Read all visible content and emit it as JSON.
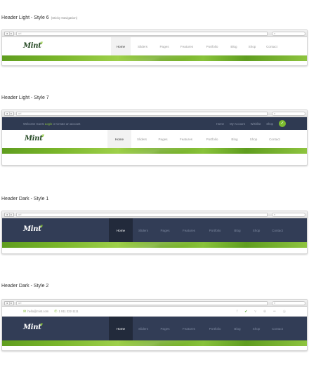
{
  "browser": {
    "nav_buttons": [
      "◂",
      "▸"
    ],
    "url_text": "url",
    "search_icon": "⌕"
  },
  "brand": {
    "logo_text": "Mint",
    "leaf_glyph": "❦",
    "green": "#8dc63f",
    "dark_navy": "#323d56"
  },
  "menu": [
    "Home",
    "Sliders",
    "Pages",
    "Features",
    "Portfolio",
    "Blog",
    "Shop",
    "Contact"
  ],
  "sections": [
    {
      "title": "Header Light - Style 6",
      "subtitle": "(Sticky Navigation)"
    },
    {
      "title": "Header Light - Style 7",
      "subtitle": ""
    },
    {
      "title": "Header Dark - Style 1",
      "subtitle": ""
    },
    {
      "title": "Header Dark - Style 2",
      "subtitle": ""
    }
  ],
  "style7_topbar": {
    "welcome": "Welcome Guest",
    "login": "Login",
    "or_text": "or",
    "create_account": "Create an account",
    "links": [
      "Home",
      "My Account",
      "Wishlist",
      "Shop"
    ],
    "cart_icon": "cart-icon"
  },
  "dark2_topbar": {
    "email": "hello@mint.com",
    "phone": "1 911 222-1111",
    "social_icons": [
      "facebook-icon",
      "twitter-icon",
      "vimeo-icon",
      "skype-icon",
      "flickr-icon",
      "dribbble-icon"
    ]
  }
}
